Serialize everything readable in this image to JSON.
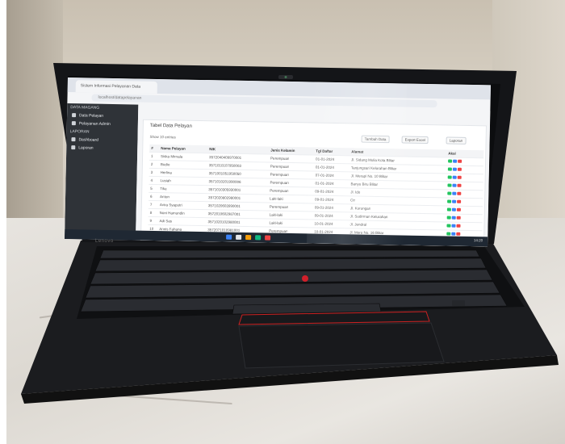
{
  "photo": {
    "subject": "laptop",
    "colors": {
      "wall": "#cfc8bc",
      "marble": "#e3e0da",
      "laptop_body": "#1b1c1f",
      "keyboard": "#0f1012",
      "trackpoint": "#d01f2a",
      "screen_sidebar": "#2f3338",
      "taskbar": "#1f2833"
    },
    "icons": [
      "webcam-icon",
      "trackpoint-icon"
    ]
  },
  "brand_text": "Lenovo",
  "screen": {
    "browser_tab": "Sistem Informasi Pelayanan Data",
    "address": "localhost/datapelayanan",
    "sidebar": {
      "title": "DATA MAGANG",
      "items": [
        {
          "label": "Data Pelayan"
        },
        {
          "label": "Pelayanan Admin"
        }
      ],
      "section": "LAPORAN",
      "items2": [
        {
          "label": "Dashboard"
        },
        {
          "label": "Laporan"
        }
      ]
    },
    "card_title": "Tabel Data Pelayan",
    "show_entries": "Show 10 entries",
    "buttons": [
      "Tambah Data",
      "Export Excel",
      "Laporan"
    ],
    "columns": [
      "#",
      "Nama Pelayan",
      "NIK",
      "Jenis Kelamin",
      "Tgl Daftar",
      "Alamat",
      "Aksi"
    ],
    "rows": [
      [
        "1",
        "Siska Mirnala",
        "3572040409970001",
        "Perempuan",
        "01-01-2024",
        "Jl. Sidang Mulia Kota Blitar"
      ],
      [
        "2",
        "Budio",
        "3571010107950003",
        "Perempuan",
        "01-01-2024",
        "Tanjungsari Kelurahan Blitar"
      ],
      [
        "3",
        "Herlina",
        "3571001051950050",
        "Perempuan",
        "07-01-2024",
        "Jl. Merapi No. 10 Blitar"
      ],
      [
        "4",
        "Lusiah",
        "3571010201990006",
        "Perempuan",
        "01-01-2024",
        "Banyu Biru Blitar"
      ],
      [
        "5",
        "Tika",
        "3571010305930001",
        "Perempuan",
        "09-01-2024",
        "Jl. Ido"
      ],
      [
        "6",
        "Anton",
        "3572020802980001",
        "Laki-laki",
        "09-01-2024",
        "Ctr"
      ],
      [
        "7",
        "Avira Syaputri",
        "3571020603990001",
        "Perempuan",
        "09-01-2024",
        "Jl. Kurungan"
      ],
      [
        "8",
        "Noni Hamundin",
        "3572010602987001",
        "Laki-laki",
        "09-01-2024",
        "Jl. Sudirman Kelurahan"
      ],
      [
        "9",
        "Adi Sas",
        "3571020102980001",
        "Laki-laki",
        "10-01-2024",
        "Jl. Jendral"
      ],
      [
        "10",
        "Annis Fahana",
        "3572071010981001",
        "Perempuan",
        "10-01-2024",
        "Jl. Moro No. 16 Blitar"
      ]
    ],
    "clock": "14:20"
  }
}
